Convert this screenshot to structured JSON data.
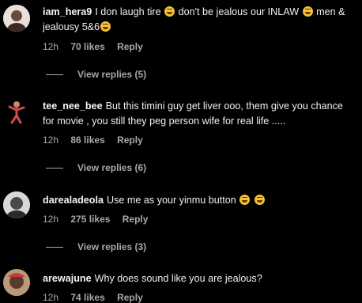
{
  "comments": [
    {
      "username": "iam_hera9",
      "text_a": "I don laugh tire ",
      "text_b": " don't be jealous our INLAW ",
      "text_c": " men & jealousy 5&6",
      "time": "12h",
      "likes": "70 likes",
      "reply": "Reply",
      "view_replies": "View replies (5)"
    },
    {
      "username": "tee_nee_bee",
      "text_a": "But this timini guy get liver ooo, them give you chance for movie , you still they peg person wife for real life .....",
      "time": "12h",
      "likes": "86 likes",
      "reply": "Reply",
      "view_replies": "View replies (6)"
    },
    {
      "username": "darealadeola",
      "text_a": "Use me as your yinmu button ",
      "time": "12h",
      "likes": "275 likes",
      "reply": "Reply",
      "view_replies": "View replies (3)"
    },
    {
      "username": "arewajune",
      "text_a": "Why does sound like you are jealous?",
      "time": "12h",
      "likes": "74 likes",
      "reply": "Reply"
    }
  ],
  "emoji_icon": "laughing-emoji-icon",
  "colors": {
    "background": "#000000",
    "text": "#f5f5f5",
    "muted": "#a8a8a8",
    "emoji": "#f7c234"
  }
}
